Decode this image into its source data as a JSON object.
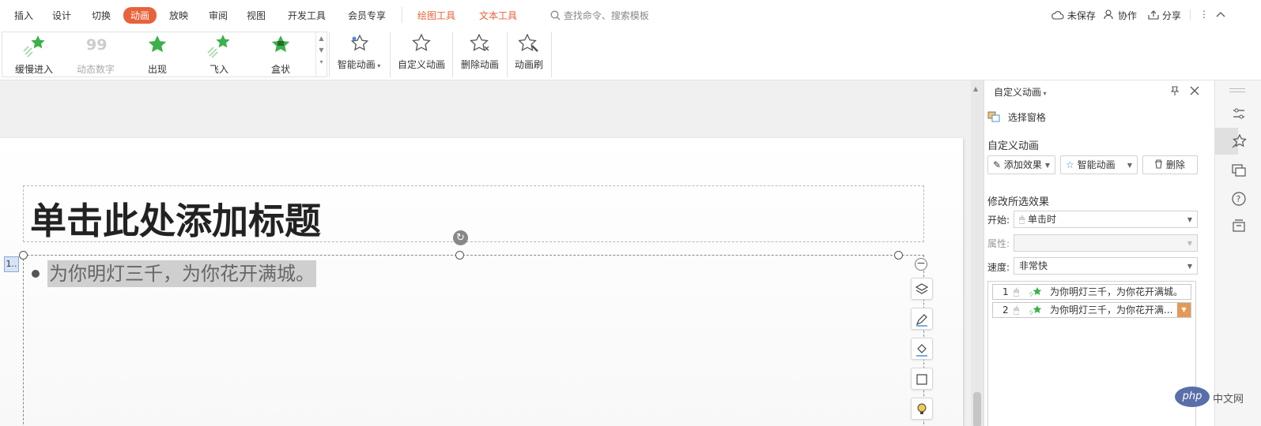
{
  "menu": {
    "items": [
      "插入",
      "设计",
      "切换",
      "动画",
      "放映",
      "审阅",
      "视图",
      "开发工具",
      "会员专享"
    ],
    "active": "动画",
    "context_tabs": [
      "绘图工具",
      "文本工具"
    ],
    "search_placeholder": "查找命令、搜索模板"
  },
  "topright": {
    "unsaved": "未保存",
    "collaborate": "协作",
    "share": "分享"
  },
  "ribbon": {
    "gallery": [
      "缓慢进入",
      "动态数字",
      "出现",
      "飞入",
      "盒状"
    ],
    "smart_anim": "智能动画",
    "custom_anim": "自定义动画",
    "delete_anim": "删除动画",
    "anim_brush": "动画刷"
  },
  "slide": {
    "title": "单击此处添加标题",
    "body_text": "为你明灯三千，为你花开满城。",
    "anim_tag": "1.."
  },
  "panel": {
    "header": "自定义动画",
    "select_pane": "选择窗格",
    "section_custom": "自定义动画",
    "add_effect": "添加效果",
    "smart_anim": "智能动画",
    "delete": "删除",
    "section_modify": "修改所选效果",
    "start_label": "开始:",
    "start_value": "单击时",
    "property_label": "属性:",
    "speed_label": "速度:",
    "speed_value": "非常快",
    "list": [
      {
        "num": "1",
        "text": "为你明灯三千，为你花开满城。"
      },
      {
        "num": "2",
        "text": "为你明灯三千，为你花开满..."
      }
    ]
  },
  "watermark": {
    "text1": "php",
    "text2": "中文网"
  },
  "colors": {
    "accent": "#e8623a",
    "star_green": "#3cb04a",
    "selected_row_dropdown": "#e39a55"
  }
}
